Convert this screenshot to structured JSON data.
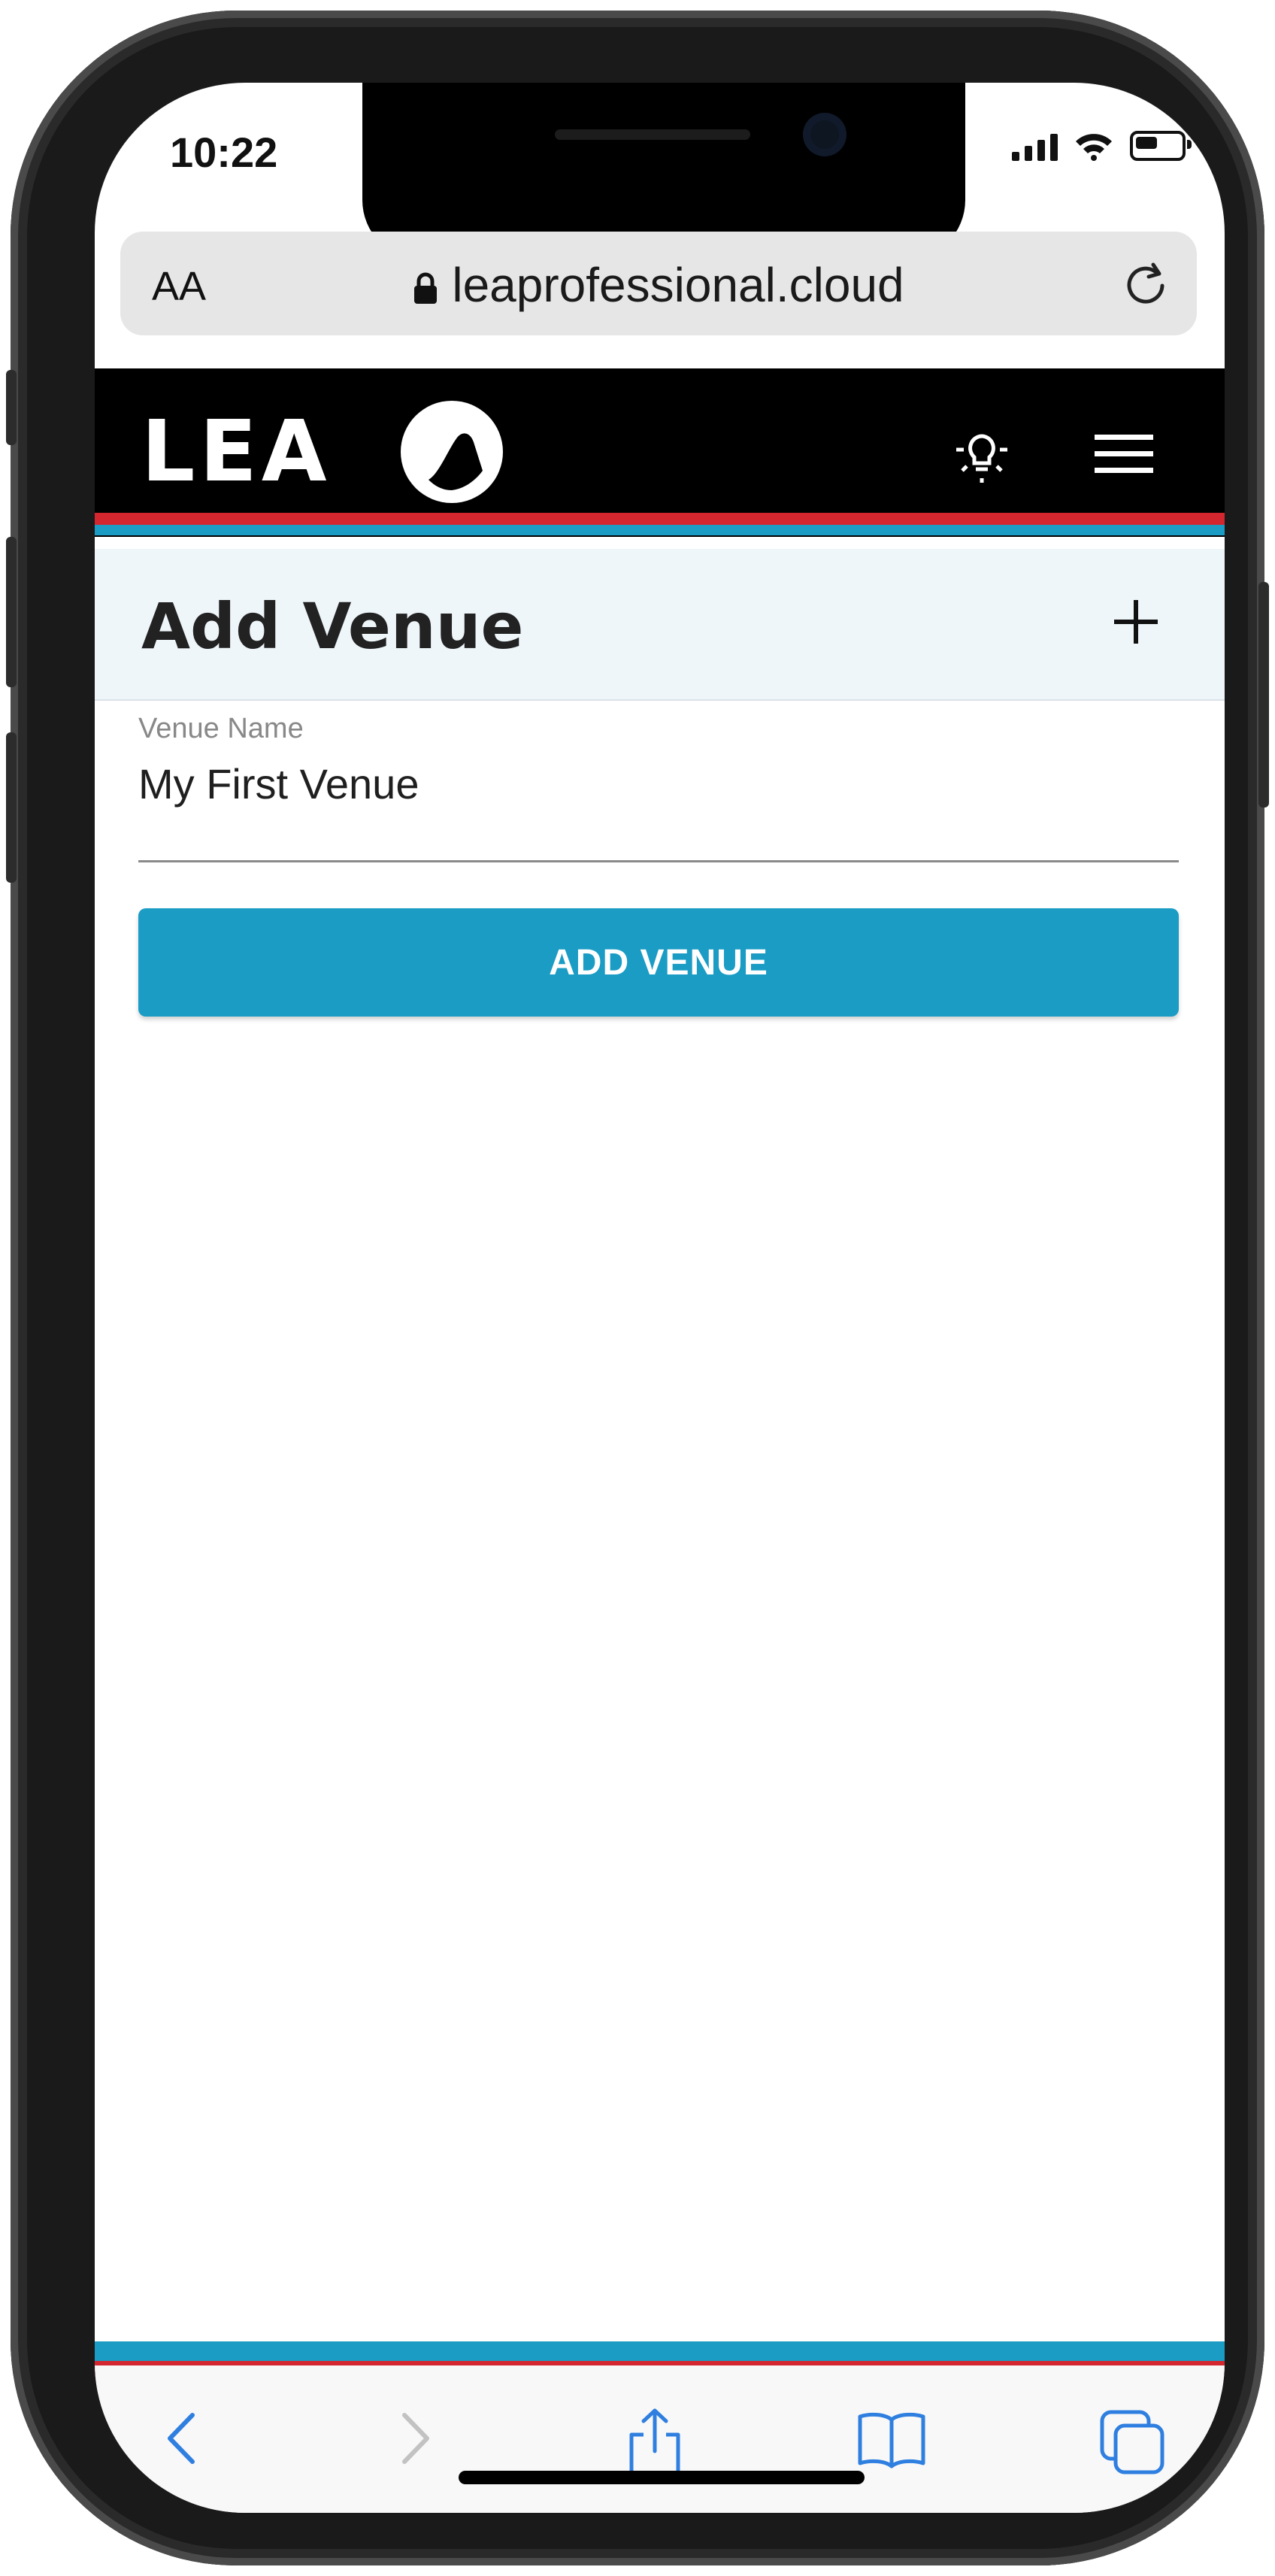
{
  "status_bar": {
    "time": "10:22"
  },
  "browser": {
    "text_size_button": "AA",
    "url": "leaprofessional.cloud"
  },
  "header": {
    "logo": "LEA",
    "icons": [
      "lightbulb-icon",
      "hamburger-menu-icon"
    ]
  },
  "page": {
    "title": "Add Venue",
    "add_icon": "plus-icon"
  },
  "form": {
    "venue_name_label": "Venue Name",
    "venue_name_value": "My First Venue",
    "submit_label": "ADD VENUE"
  },
  "toolbar": {
    "icons": [
      "back-icon",
      "forward-icon",
      "share-icon",
      "bookmarks-icon",
      "tabs-icon"
    ]
  },
  "colors": {
    "brand_blue": "#1a9cc4",
    "brand_red": "#d4262f",
    "header_bg": "#000000",
    "section_bg": "#eff6fa"
  }
}
